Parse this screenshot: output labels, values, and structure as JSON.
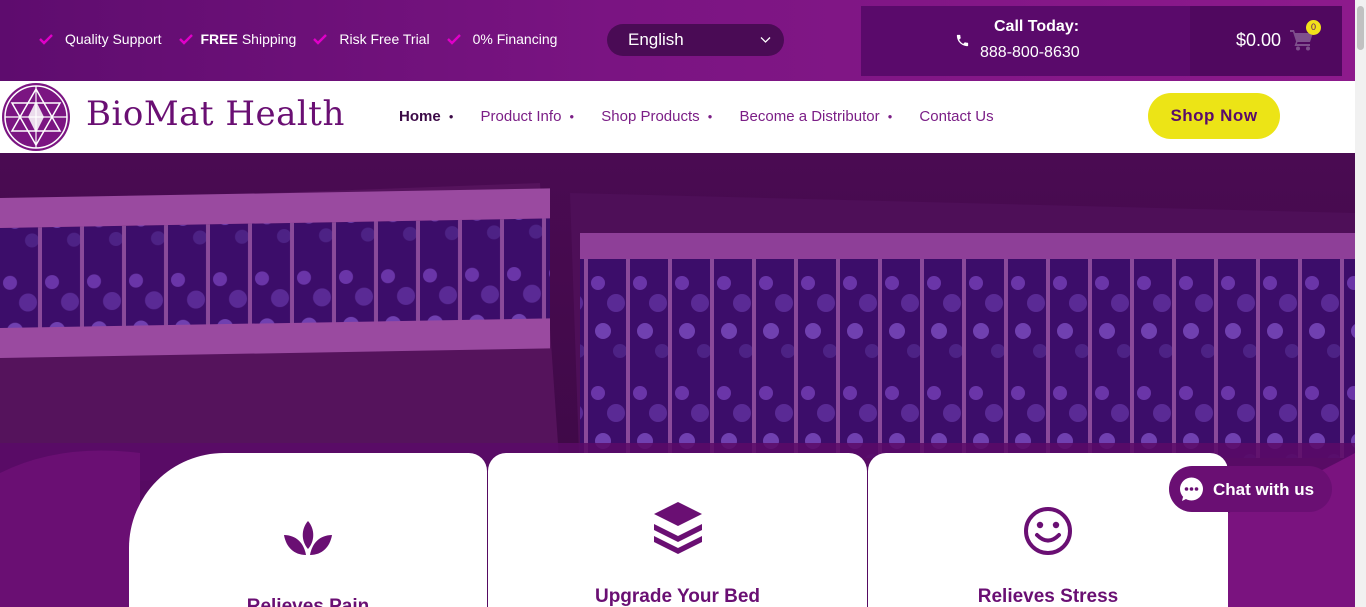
{
  "topbar": {
    "perks": [
      {
        "bold": "",
        "text": "Quality Support"
      },
      {
        "bold": "FREE",
        "text": "Shipping"
      },
      {
        "bold": "",
        "text": "Risk Free Trial"
      },
      {
        "bold": "",
        "text": "0% Financing"
      }
    ],
    "language": "English",
    "call": {
      "title": "Call Today:",
      "number": "888-800-8630"
    },
    "cart": {
      "total": "$0.00",
      "count": "0"
    }
  },
  "header": {
    "logo_text": "BioMat Health",
    "nav": [
      {
        "label": "Home"
      },
      {
        "label": "Product Info"
      },
      {
        "label": "Shop Products"
      },
      {
        "label": "Become a Distributor"
      },
      {
        "label": "Contact Us"
      }
    ],
    "cta": "Shop Now"
  },
  "hero": {
    "cards": [
      {
        "title": "Relieves Pain",
        "icon": "lotus-icon"
      },
      {
        "title": "Upgrade Your Bed",
        "icon": "layers-icon"
      },
      {
        "title": "Relieves Stress",
        "icon": "smile-icon"
      }
    ]
  },
  "chat": {
    "label": "Chat with us"
  },
  "colors": {
    "brand_purple": "#6a0f73",
    "accent_yellow": "#ece416",
    "check_magenta": "#e000c8"
  }
}
